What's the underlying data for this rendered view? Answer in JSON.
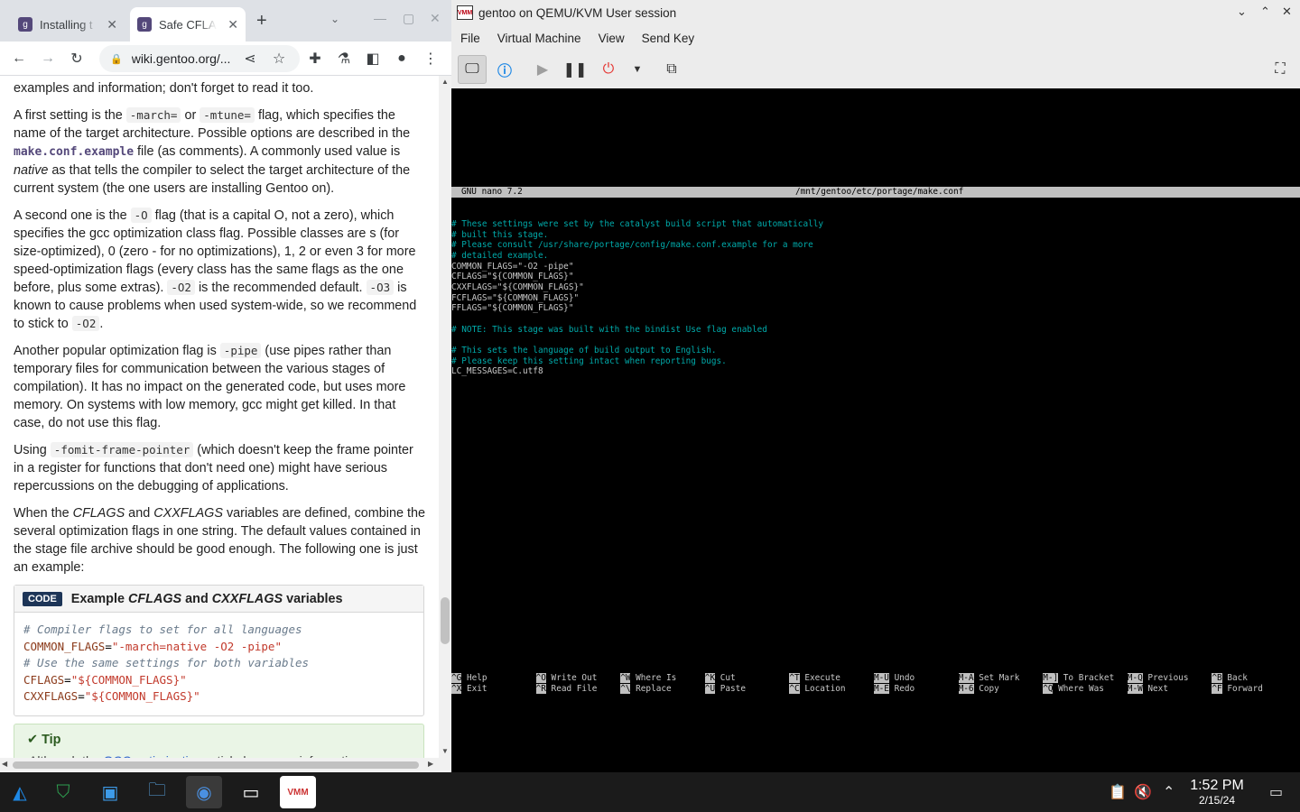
{
  "browser": {
    "tabs": [
      {
        "title": "Installing t",
        "favicon": "gentoo-icon"
      },
      {
        "title": "Safe CFLAGS",
        "favicon": "gentoo-icon"
      }
    ],
    "close_glyph": "✕",
    "new_tab_glyph": "+",
    "url": "wiki.gentoo.org/..."
  },
  "article": {
    "p0": "examples and information; don't forget to read it too.",
    "p1": {
      "a": "A first setting is the ",
      "code1": "-march=",
      "b": " or ",
      "code2": "-mtune=",
      "c": " flag, which specifies the name of the target architecture. Possible options are described in the ",
      "link": "make.conf.example",
      "d": " file (as comments). A commonly used value is ",
      "em": "native",
      "e": " as that tells the compiler to select the target architecture of the current system (the one users are installing Gentoo on)."
    },
    "p2": {
      "a": "A second one is the ",
      "code1": "-O",
      "b": " flag (that is a capital O, not a zero), which specifies the gcc optimization class flag. Possible classes are s (for size-optimized), 0 (zero - for no optimizations), 1, 2 or even 3 for more speed-optimization flags (every class has the same flags as the one before, plus some extras). ",
      "code2": "-O2",
      "c": " is the recommended default. ",
      "code3": "-O3",
      "d": " is known to cause problems when used system-wide, so we recommend to stick to ",
      "code4": "-O2",
      "e": "."
    },
    "p3": {
      "a": "Another popular optimization flag is ",
      "code1": "-pipe",
      "b": " (use pipes rather than temporary files for communication between the various stages of compilation). It has no impact on the generated code, but uses more memory. On systems with low memory, gcc might get killed. In that case, do not use this flag."
    },
    "p4": {
      "a": "Using ",
      "code1": "-fomit-frame-pointer",
      "b": " (which doesn't keep the frame pointer in a register for functions that don't need one) might have serious repercussions on the debugging of applications."
    },
    "p5": {
      "a": "When the ",
      "em1": "CFLAGS",
      "b": " and ",
      "em2": "CXXFLAGS",
      "c": " variables are defined, combine the several optimization flags in one string. The default values contained in the stage file archive should be good enough. The following one is just an example:"
    },
    "codebox": {
      "badge": "CODE",
      "title_a": "Example ",
      "title_em1": "CFLAGS",
      "title_b": " and ",
      "title_em2": "CXXFLAGS",
      "title_c": " variables",
      "l1": "# Compiler flags to set for all languages",
      "l2k": "COMMON_FLAGS",
      "l2s": "\"-march=native -O2 -pipe\"",
      "l3": "# Use the same settings for both variables",
      "l4k": "CFLAGS",
      "l4s": "\"${COMMON_FLAGS}\"",
      "l5k": "CXXFLAGS",
      "l5s": "\"${COMMON_FLAGS}\""
    },
    "tip": {
      "title": "Tip",
      "text_a": "Although the ",
      "text_link": "GCC optimization",
      "text_b": " article has more information on"
    }
  },
  "vm": {
    "title": "gentoo on QEMU/KVM User session",
    "logo_text": "VMM",
    "menu": [
      "File",
      "Virtual Machine",
      "View",
      "Send Key"
    ]
  },
  "terminal": {
    "header_left": "GNU nano 7.2",
    "header_center": "/mnt/gentoo/etc/portage/make.conf",
    "lines": [
      {
        "cls": "cm",
        "text": "# These settings were set by the catalyst build script that automatically"
      },
      {
        "cls": "cm",
        "text": "# built this stage."
      },
      {
        "cls": "cm",
        "text": "# Please consult /usr/share/portage/config/make.conf.example for a more"
      },
      {
        "cls": "cm",
        "text": "# detailed example."
      },
      {
        "cls": "tx",
        "text": "COMMON_FLAGS=\"-O2 -pipe\""
      },
      {
        "cls": "tx",
        "text": "CFLAGS=\"${COMMON_FLAGS}\""
      },
      {
        "cls": "tx",
        "text": "CXXFLAGS=\"${COMMON_FLAGS}\""
      },
      {
        "cls": "tx",
        "text": "FCFLAGS=\"${COMMON_FLAGS}\""
      },
      {
        "cls": "tx",
        "text": "FFLAGS=\"${COMMON_FLAGS}\""
      },
      {
        "cls": "tx",
        "text": ""
      },
      {
        "cls": "cm",
        "text": "# NOTE: This stage was built with the bindist Use flag enabled"
      },
      {
        "cls": "tx",
        "text": ""
      },
      {
        "cls": "cm",
        "text": "# This sets the language of build output to English."
      },
      {
        "cls": "cm",
        "text": "# Please keep this setting intact when reporting bugs."
      },
      {
        "cls": "tx",
        "text": "LC_MESSAGES=C.utf8"
      }
    ],
    "shortcuts": [
      {
        "k1": "^G",
        "l1": "Help",
        "k2": "^X",
        "l2": "Exit"
      },
      {
        "k1": "^O",
        "l1": "Write Out",
        "k2": "^R",
        "l2": "Read File"
      },
      {
        "k1": "^W",
        "l1": "Where Is",
        "k2": "^\\",
        "l2": "Replace"
      },
      {
        "k1": "^K",
        "l1": "Cut",
        "k2": "^U",
        "l2": "Paste"
      },
      {
        "k1": "^T",
        "l1": "Execute",
        "k2": "^C",
        "l2": "Location"
      },
      {
        "k1": "M-U",
        "l1": "Undo",
        "k2": "M-E",
        "l2": "Redo"
      },
      {
        "k1": "M-A",
        "l1": "Set Mark",
        "k2": "M-6",
        "l2": "Copy"
      },
      {
        "k1": "M-]",
        "l1": "To Bracket",
        "k2": "^Q",
        "l2": "Where Was"
      },
      {
        "k1": "M-Q",
        "l1": "Previous",
        "k2": "M-W",
        "l2": "Next"
      },
      {
        "k1": "^B",
        "l1": "Back",
        "k2": "^F",
        "l2": "Forward"
      }
    ]
  },
  "taskbar": {
    "time": "1:52 PM",
    "date": "2/15/24"
  },
  "colors": {
    "terminal_comment": "#00aaaa",
    "code_badge": "#1d3557",
    "tip_bg": "#eaf5e6",
    "power_red": "#e53935",
    "info_blue": "#1e88e5"
  }
}
